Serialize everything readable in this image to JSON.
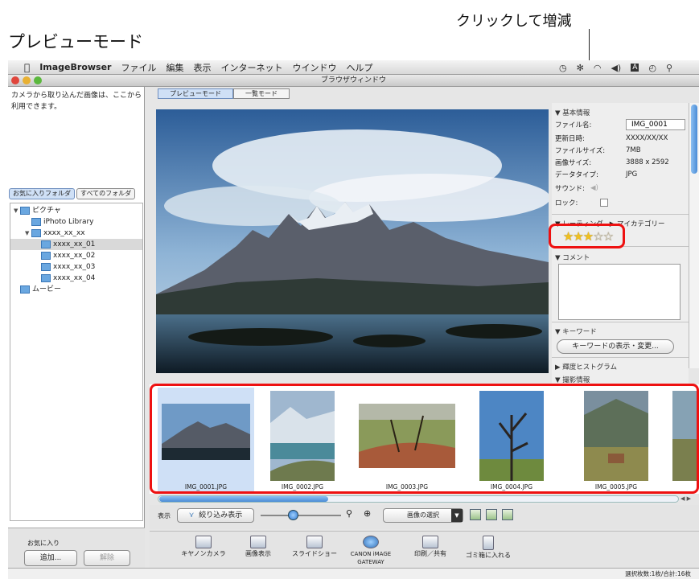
{
  "heading": "プレビューモード",
  "callout": "クリックして増減",
  "menubar": {
    "app": "ImageBrowser",
    "items": [
      "ファイル",
      "編集",
      "表示",
      "インターネット",
      "ウインドウ",
      "ヘルプ"
    ],
    "icons": [
      "clock-icon",
      "bluetooth-icon",
      "wifi-icon",
      "volume-icon",
      "input-icon",
      "time-machine-icon",
      "spotlight-icon"
    ]
  },
  "window_title": "ブラウザウィンドウ",
  "left": {
    "info": "カメラから取り込んだ画像は、ここから利用できます。",
    "tabs": [
      "お気に入りフォルダ",
      "すべてのフォルダ"
    ],
    "tree": [
      {
        "label": "ピクチャ",
        "depth": 0,
        "expanded": true
      },
      {
        "label": "iPhoto Library",
        "depth": 1
      },
      {
        "label": "xxxx_xx_xx",
        "depth": 1,
        "expanded": true
      },
      {
        "label": "xxxx_xx_01",
        "depth": 2,
        "selected": true
      },
      {
        "label": "xxxx_xx_02",
        "depth": 2
      },
      {
        "label": "xxxx_xx_03",
        "depth": 2
      },
      {
        "label": "xxxx_xx_04",
        "depth": 2
      },
      {
        "label": "ムービー",
        "depth": 0
      }
    ],
    "favorites": {
      "label": "お気に入り",
      "add": "追加...",
      "remove": "解除"
    }
  },
  "tabs": [
    "プレビューモード",
    "一覧モード"
  ],
  "info": {
    "section_basic": "▼ 基本情報",
    "filename_label": "ファイル名:",
    "filename_value": "IMG_0001",
    "updated_label": "更新日時:",
    "updated_value": "XXXX/XX/XX",
    "size_label": "ファイルサイズ:",
    "size_value": "7MB",
    "dims_label": "画像サイズ:",
    "dims_value": "3888 x 2592",
    "type_label": "データタイプ:",
    "type_value": "JPG",
    "sound_label": "サウンド:",
    "lock_label": "ロック:",
    "rating_section": "▼ レーティング",
    "category_section": "▶ マイカテゴリー",
    "rating": 3,
    "rating_max": 5,
    "comment_section": "▼ コメント",
    "keyword_section": "▼ キーワード",
    "keyword_button": "キーワードの表示・変更...",
    "histogram_section": "▶ 輝度ヒストグラム",
    "shooting_section": "▼ 撮影情報"
  },
  "thumbnails": [
    "IMG_0001.JPG",
    "IMG_0002.JPG",
    "IMG_0003.JPG",
    "IMG_0004.JPG",
    "IMG_0005.JPG"
  ],
  "controls": {
    "display_label": "表示",
    "filter_button": "絞り込み表示",
    "select_label": "画像の選択"
  },
  "tools": [
    "キヤノンカメラ",
    "画像表示",
    "スライドショー",
    "CANON iMAGE GATEWAY",
    "印刷／共有",
    "ゴミ箱に入れる"
  ],
  "status": "選択枚数:1枚/合計:16枚",
  "colors": {
    "highlight": "#e11111",
    "selection": "#cfe0f6"
  }
}
